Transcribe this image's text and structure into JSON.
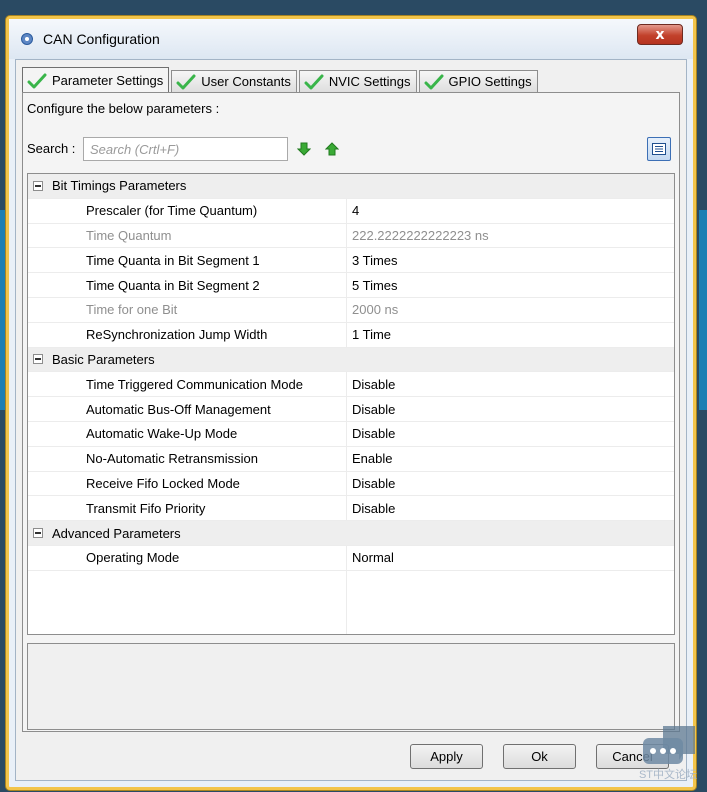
{
  "window": {
    "title": "CAN Configuration",
    "close_label": "x"
  },
  "tabs": [
    {
      "label": "Parameter Settings",
      "active": true
    },
    {
      "label": "User Constants",
      "active": false
    },
    {
      "label": "NVIC Settings",
      "active": false
    },
    {
      "label": "GPIO Settings",
      "active": false
    }
  ],
  "panel": {
    "configure_label": "Configure the below parameters :",
    "search_label": "Search :",
    "search_placeholder": "Search (Crtl+F)"
  },
  "groups": [
    {
      "name": "Bit Timings Parameters",
      "params": [
        {
          "name": "Prescaler (for Time Quantum)",
          "value": "4",
          "disabled": false
        },
        {
          "name": "Time Quantum",
          "value": "222.2222222222223 ns",
          "disabled": true
        },
        {
          "name": "Time Quanta in Bit Segment 1",
          "value": "3 Times",
          "disabled": false
        },
        {
          "name": "Time Quanta in Bit Segment 2",
          "value": "5 Times",
          "disabled": false
        },
        {
          "name": "Time for one Bit",
          "value": "2000 ns",
          "disabled": true
        },
        {
          "name": "ReSynchronization Jump Width",
          "value": "1 Time",
          "disabled": false
        }
      ]
    },
    {
      "name": "Basic Parameters",
      "params": [
        {
          "name": "Time Triggered Communication Mode",
          "value": "Disable",
          "disabled": false
        },
        {
          "name": "Automatic Bus-Off Management",
          "value": "Disable",
          "disabled": false
        },
        {
          "name": "Automatic Wake-Up Mode",
          "value": "Disable",
          "disabled": false
        },
        {
          "name": "No-Automatic Retransmission",
          "value": "Enable",
          "disabled": false
        },
        {
          "name": "Receive Fifo Locked Mode",
          "value": "Disable",
          "disabled": false
        },
        {
          "name": "Transmit Fifo Priority",
          "value": "Disable",
          "disabled": false
        }
      ]
    },
    {
      "name": "Advanced Parameters",
      "params": [
        {
          "name": "Operating Mode",
          "value": "Normal",
          "disabled": false
        }
      ]
    }
  ],
  "buttons": {
    "apply": "Apply",
    "ok": "Ok",
    "cancel": "Cancel"
  },
  "watermark": "ST中文论坛",
  "colors": {
    "accent": "#f2c44a",
    "check": "#39b54a",
    "close": "#c2412b"
  }
}
